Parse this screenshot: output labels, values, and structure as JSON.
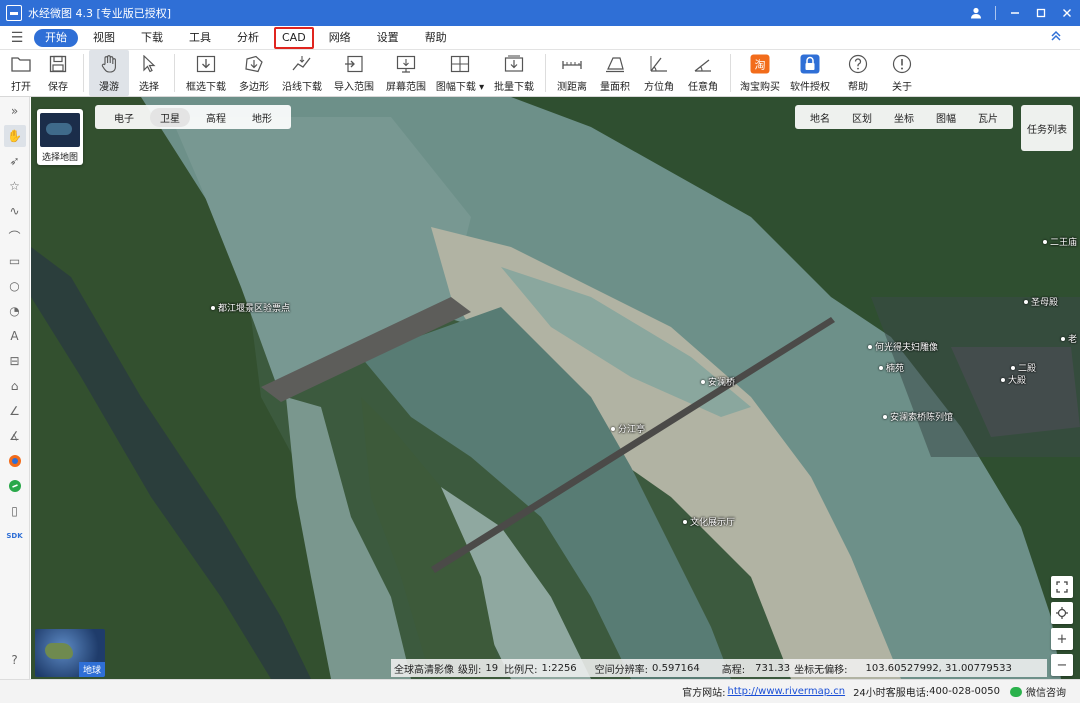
{
  "window": {
    "title": "水经微图 4.3 [专业版已授权]",
    "controls": [
      "user",
      "minimize",
      "maximize",
      "close"
    ]
  },
  "menu": {
    "tabs": [
      "开始",
      "视图",
      "下载",
      "工具",
      "分析",
      "CAD",
      "网络",
      "设置",
      "帮助"
    ],
    "active_tab": "开始",
    "highlighted_tab": "CAD",
    "highlight_color": "#e0251f"
  },
  "toolbar": {
    "items": [
      {
        "label": "打开",
        "icon": "folder-icon"
      },
      {
        "label": "保存",
        "icon": "save-icon"
      },
      {
        "label": "漫游",
        "icon": "hand-icon"
      },
      {
        "label": "选择",
        "icon": "cursor-icon"
      },
      {
        "label": "框选下载",
        "icon": "box-download-icon"
      },
      {
        "label": "多边形",
        "icon": "polygon-download-icon"
      },
      {
        "label": "沿线下载",
        "icon": "line-download-icon"
      },
      {
        "label": "导入范围",
        "icon": "import-range-icon"
      },
      {
        "label": "屏幕范围",
        "icon": "screen-range-icon"
      },
      {
        "label": "图幅下载",
        "icon": "sheet-download-icon"
      },
      {
        "label": "批量下载",
        "icon": "batch-download-icon"
      },
      {
        "label": "测距离",
        "icon": "measure-distance-icon"
      },
      {
        "label": "量面积",
        "icon": "measure-area-icon"
      },
      {
        "label": "方位角",
        "icon": "azimuth-icon"
      },
      {
        "label": "任意角",
        "icon": "any-angle-icon"
      },
      {
        "label": "淘宝购买",
        "icon": "taobao-icon"
      },
      {
        "label": "软件授权",
        "icon": "license-icon"
      },
      {
        "label": "帮助",
        "icon": "help-icon"
      },
      {
        "label": "关于",
        "icon": "about-icon"
      }
    ],
    "pressed": "漫游"
  },
  "map": {
    "thumb_label": "选择地图",
    "map_types": [
      "电子",
      "卫星",
      "高程",
      "地形"
    ],
    "active_map_type": "卫星",
    "layers": [
      "地名",
      "区划",
      "坐标",
      "图幅",
      "瓦片"
    ],
    "task_list": "任务列表",
    "globe_label": "地球",
    "pois": [
      {
        "name": "都江堰景区验票点"
      },
      {
        "name": "安澜桥"
      },
      {
        "name": "分江亭"
      },
      {
        "name": "文化展示厅"
      },
      {
        "name": "何光得夫妇雕像"
      },
      {
        "name": "楠苑"
      },
      {
        "name": "安澜索桥陈列馆"
      },
      {
        "name": "圣母殿"
      },
      {
        "name": "二殿"
      },
      {
        "name": "大殿"
      },
      {
        "name": "二王庙"
      },
      {
        "name": "老"
      }
    ],
    "status": {
      "source": "全球高清影像",
      "level_label": "级别:",
      "level": "19",
      "scale_label": "比例尺:",
      "scale": "1:2256",
      "resolution_label": "空间分辨率:",
      "resolution": "0.597164",
      "elevation_label": "高程:",
      "elevation": "731.33",
      "coord_label": "坐标无偏移:",
      "coord": "103.60527992, 31.00779533"
    }
  },
  "statusbar": {
    "website_label": "官方网站:",
    "website": "http://www.rivermap.cn",
    "phone_label": "24小时客服电话:",
    "phone": "400-028-0050",
    "wechat": "微信咨询"
  }
}
